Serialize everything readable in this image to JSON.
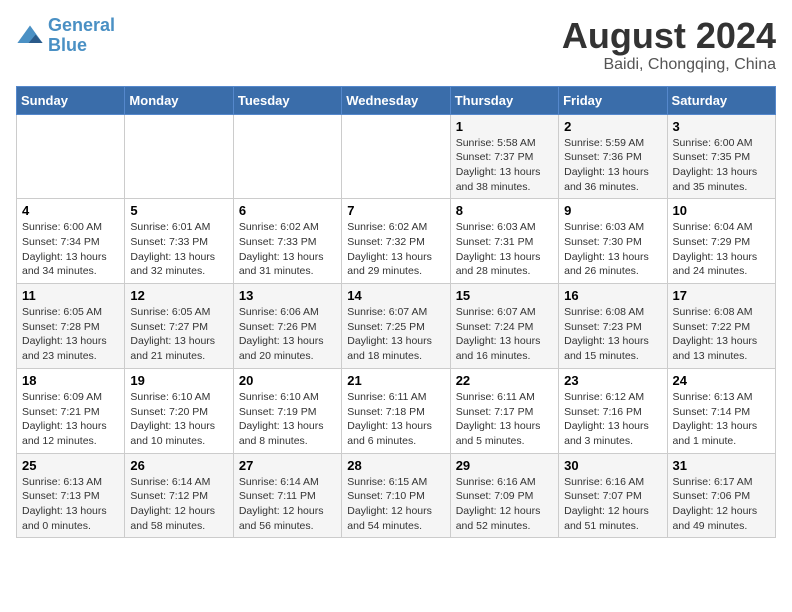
{
  "logo": {
    "line1": "General",
    "line2": "Blue"
  },
  "title": "August 2024",
  "subtitle": "Baidi, Chongqing, China",
  "days_of_week": [
    "Sunday",
    "Monday",
    "Tuesday",
    "Wednesday",
    "Thursday",
    "Friday",
    "Saturday"
  ],
  "weeks": [
    [
      {
        "day": "",
        "info": ""
      },
      {
        "day": "",
        "info": ""
      },
      {
        "day": "",
        "info": ""
      },
      {
        "day": "",
        "info": ""
      },
      {
        "day": "1",
        "info": "Sunrise: 5:58 AM\nSunset: 7:37 PM\nDaylight: 13 hours\nand 38 minutes."
      },
      {
        "day": "2",
        "info": "Sunrise: 5:59 AM\nSunset: 7:36 PM\nDaylight: 13 hours\nand 36 minutes."
      },
      {
        "day": "3",
        "info": "Sunrise: 6:00 AM\nSunset: 7:35 PM\nDaylight: 13 hours\nand 35 minutes."
      }
    ],
    [
      {
        "day": "4",
        "info": "Sunrise: 6:00 AM\nSunset: 7:34 PM\nDaylight: 13 hours\nand 34 minutes."
      },
      {
        "day": "5",
        "info": "Sunrise: 6:01 AM\nSunset: 7:33 PM\nDaylight: 13 hours\nand 32 minutes."
      },
      {
        "day": "6",
        "info": "Sunrise: 6:02 AM\nSunset: 7:33 PM\nDaylight: 13 hours\nand 31 minutes."
      },
      {
        "day": "7",
        "info": "Sunrise: 6:02 AM\nSunset: 7:32 PM\nDaylight: 13 hours\nand 29 minutes."
      },
      {
        "day": "8",
        "info": "Sunrise: 6:03 AM\nSunset: 7:31 PM\nDaylight: 13 hours\nand 28 minutes."
      },
      {
        "day": "9",
        "info": "Sunrise: 6:03 AM\nSunset: 7:30 PM\nDaylight: 13 hours\nand 26 minutes."
      },
      {
        "day": "10",
        "info": "Sunrise: 6:04 AM\nSunset: 7:29 PM\nDaylight: 13 hours\nand 24 minutes."
      }
    ],
    [
      {
        "day": "11",
        "info": "Sunrise: 6:05 AM\nSunset: 7:28 PM\nDaylight: 13 hours\nand 23 minutes."
      },
      {
        "day": "12",
        "info": "Sunrise: 6:05 AM\nSunset: 7:27 PM\nDaylight: 13 hours\nand 21 minutes."
      },
      {
        "day": "13",
        "info": "Sunrise: 6:06 AM\nSunset: 7:26 PM\nDaylight: 13 hours\nand 20 minutes."
      },
      {
        "day": "14",
        "info": "Sunrise: 6:07 AM\nSunset: 7:25 PM\nDaylight: 13 hours\nand 18 minutes."
      },
      {
        "day": "15",
        "info": "Sunrise: 6:07 AM\nSunset: 7:24 PM\nDaylight: 13 hours\nand 16 minutes."
      },
      {
        "day": "16",
        "info": "Sunrise: 6:08 AM\nSunset: 7:23 PM\nDaylight: 13 hours\nand 15 minutes."
      },
      {
        "day": "17",
        "info": "Sunrise: 6:08 AM\nSunset: 7:22 PM\nDaylight: 13 hours\nand 13 minutes."
      }
    ],
    [
      {
        "day": "18",
        "info": "Sunrise: 6:09 AM\nSunset: 7:21 PM\nDaylight: 13 hours\nand 12 minutes."
      },
      {
        "day": "19",
        "info": "Sunrise: 6:10 AM\nSunset: 7:20 PM\nDaylight: 13 hours\nand 10 minutes."
      },
      {
        "day": "20",
        "info": "Sunrise: 6:10 AM\nSunset: 7:19 PM\nDaylight: 13 hours\nand 8 minutes."
      },
      {
        "day": "21",
        "info": "Sunrise: 6:11 AM\nSunset: 7:18 PM\nDaylight: 13 hours\nand 6 minutes."
      },
      {
        "day": "22",
        "info": "Sunrise: 6:11 AM\nSunset: 7:17 PM\nDaylight: 13 hours\nand 5 minutes."
      },
      {
        "day": "23",
        "info": "Sunrise: 6:12 AM\nSunset: 7:16 PM\nDaylight: 13 hours\nand 3 minutes."
      },
      {
        "day": "24",
        "info": "Sunrise: 6:13 AM\nSunset: 7:14 PM\nDaylight: 13 hours\nand 1 minute."
      }
    ],
    [
      {
        "day": "25",
        "info": "Sunrise: 6:13 AM\nSunset: 7:13 PM\nDaylight: 13 hours\nand 0 minutes."
      },
      {
        "day": "26",
        "info": "Sunrise: 6:14 AM\nSunset: 7:12 PM\nDaylight: 12 hours\nand 58 minutes."
      },
      {
        "day": "27",
        "info": "Sunrise: 6:14 AM\nSunset: 7:11 PM\nDaylight: 12 hours\nand 56 minutes."
      },
      {
        "day": "28",
        "info": "Sunrise: 6:15 AM\nSunset: 7:10 PM\nDaylight: 12 hours\nand 54 minutes."
      },
      {
        "day": "29",
        "info": "Sunrise: 6:16 AM\nSunset: 7:09 PM\nDaylight: 12 hours\nand 52 minutes."
      },
      {
        "day": "30",
        "info": "Sunrise: 6:16 AM\nSunset: 7:07 PM\nDaylight: 12 hours\nand 51 minutes."
      },
      {
        "day": "31",
        "info": "Sunrise: 6:17 AM\nSunset: 7:06 PM\nDaylight: 12 hours\nand 49 minutes."
      }
    ]
  ]
}
